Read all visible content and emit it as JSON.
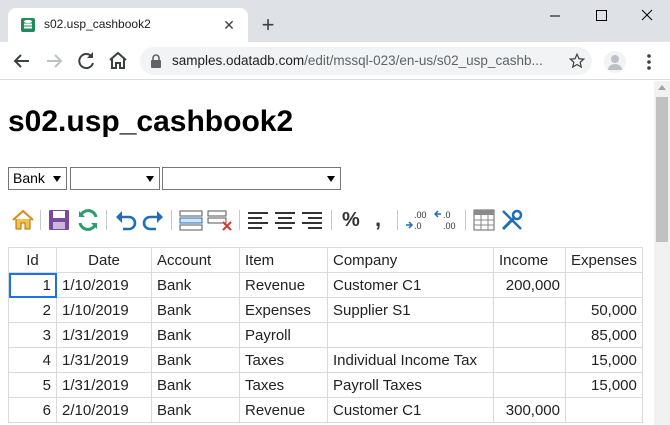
{
  "browser": {
    "tab_title": "s02.usp_cashbook2",
    "new_tab_label": "+",
    "url_host": "samples.odatadb.com",
    "url_path": "/edit/mssql-023/en-us/s02_usp_cashb..."
  },
  "page": {
    "title": "s02.usp_cashbook2",
    "filters": [
      {
        "selected": "Bank"
      },
      {
        "selected": ""
      },
      {
        "selected": ""
      }
    ]
  },
  "toolbar": {
    "percent_label": "%",
    "comma_label": ","
  },
  "grid": {
    "columns": [
      "Id",
      "Date",
      "Account",
      "Item",
      "Company",
      "Income",
      "Expenses"
    ],
    "rows": [
      {
        "id": "1",
        "date": "1/10/2019",
        "account": "Bank",
        "item": "Revenue",
        "company": "Customer C1",
        "income": "200,000",
        "expenses": ""
      },
      {
        "id": "2",
        "date": "1/10/2019",
        "account": "Bank",
        "item": "Expenses",
        "company": "Supplier S1",
        "income": "",
        "expenses": "50,000"
      },
      {
        "id": "3",
        "date": "1/31/2019",
        "account": "Bank",
        "item": "Payroll",
        "company": "",
        "income": "",
        "expenses": "85,000"
      },
      {
        "id": "4",
        "date": "1/31/2019",
        "account": "Bank",
        "item": "Taxes",
        "company": "Individual Income Tax",
        "income": "",
        "expenses": "15,000"
      },
      {
        "id": "5",
        "date": "1/31/2019",
        "account": "Bank",
        "item": "Taxes",
        "company": "Payroll Taxes",
        "income": "",
        "expenses": "15,000"
      },
      {
        "id": "6",
        "date": "2/10/2019",
        "account": "Bank",
        "item": "Revenue",
        "company": "Customer C1",
        "income": "300,000",
        "expenses": ""
      }
    ]
  },
  "colors": {
    "tab_strip": "#dee1e6",
    "icon_blue": "#1f6fb8",
    "icon_green": "#2e9e6e",
    "delete_red": "#d9382f"
  }
}
